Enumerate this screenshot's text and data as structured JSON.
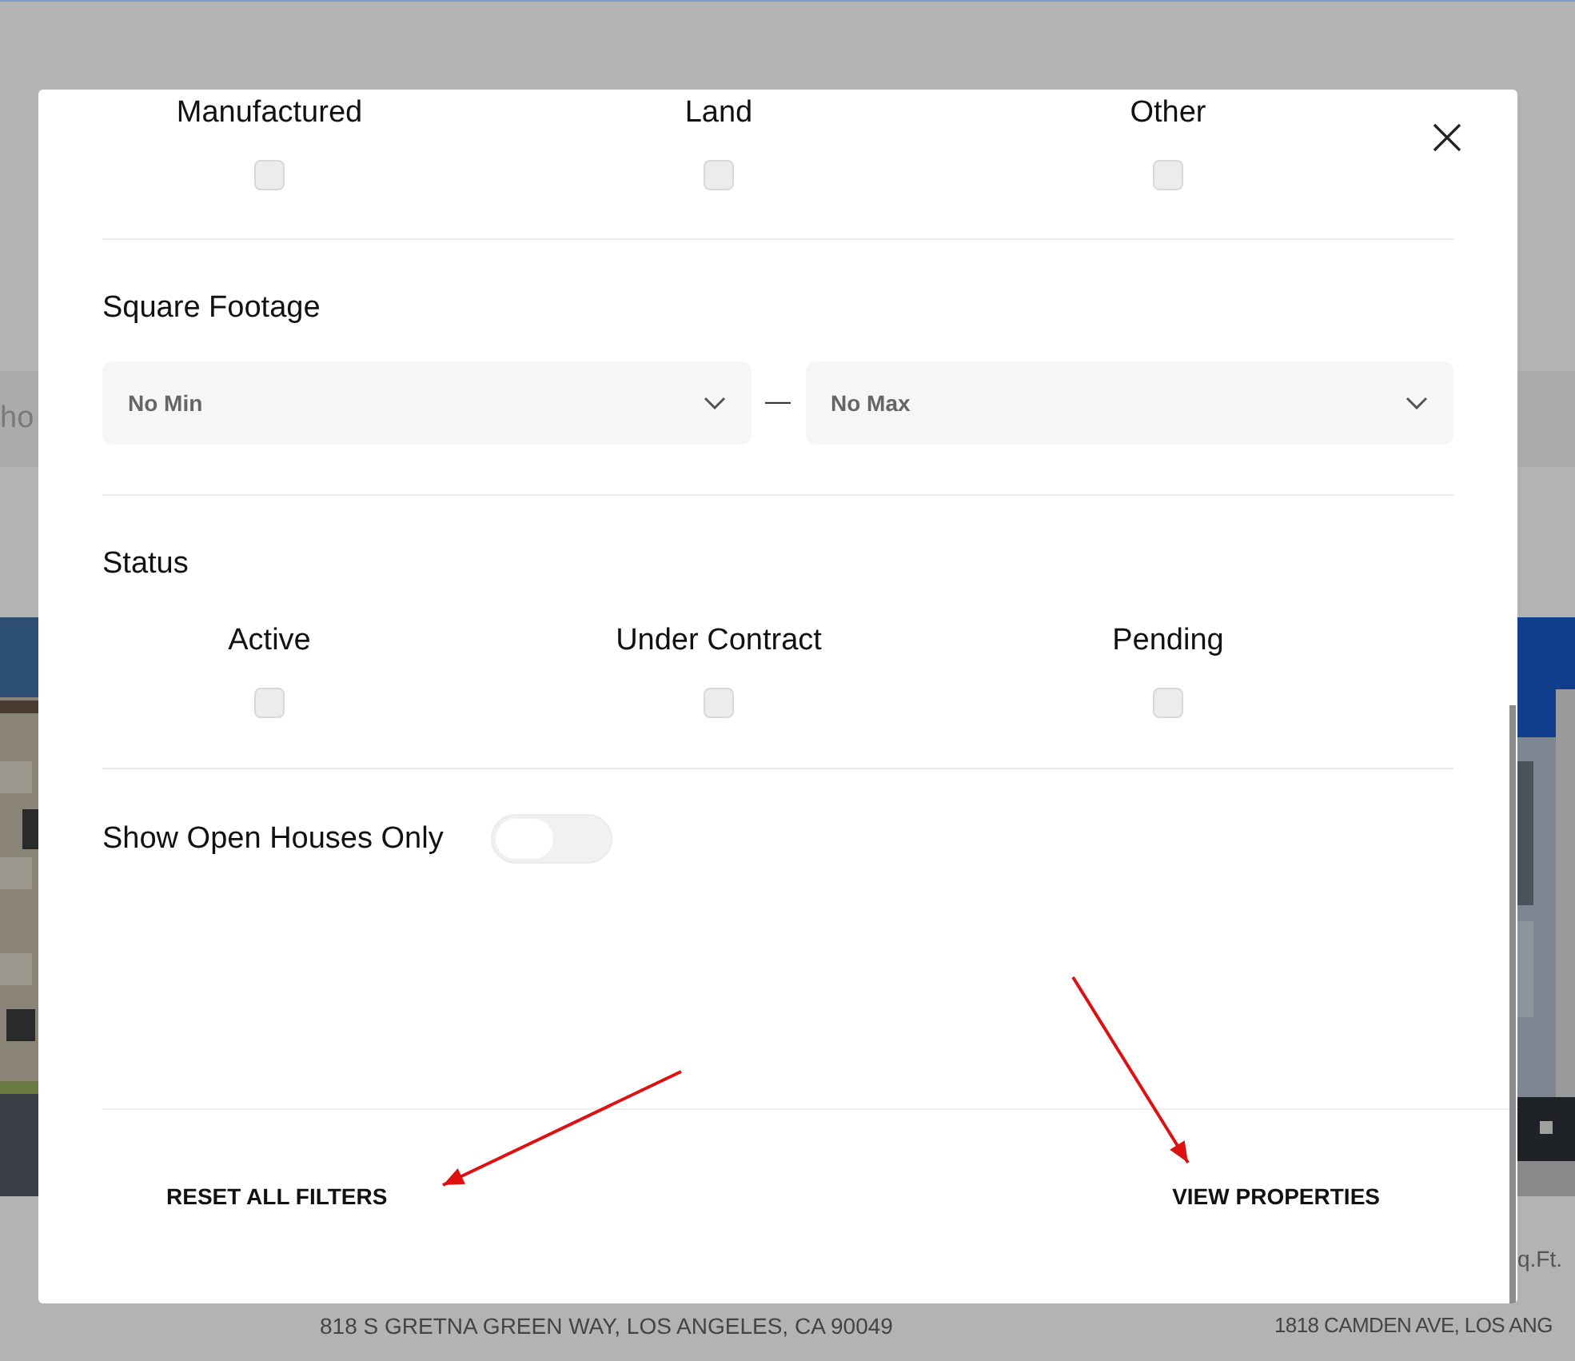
{
  "background": {
    "search_text": "ho",
    "listing_detail": "q.Ft.",
    "addresses": [
      "818 S GRETNA GREEN WAY, LOS ANGELES, CA 90049",
      "1818 CAMDEN AVE, LOS ANG"
    ]
  },
  "property_types": [
    {
      "label": "Manufactured",
      "checked": false
    },
    {
      "label": "Land",
      "checked": false
    },
    {
      "label": "Other",
      "checked": false
    }
  ],
  "square_footage": {
    "title": "Square Footage",
    "min": "No Min",
    "separator": "—",
    "max": "No Max"
  },
  "status": {
    "title": "Status",
    "options": [
      {
        "label": "Active",
        "checked": false
      },
      {
        "label": "Under Contract",
        "checked": false
      },
      {
        "label": "Pending",
        "checked": false
      }
    ]
  },
  "open_houses": {
    "label": "Show Open Houses Only",
    "on": false
  },
  "buttons": [
    "RESET ALL FILTERS",
    "VIEW PROPERTIES"
  ]
}
